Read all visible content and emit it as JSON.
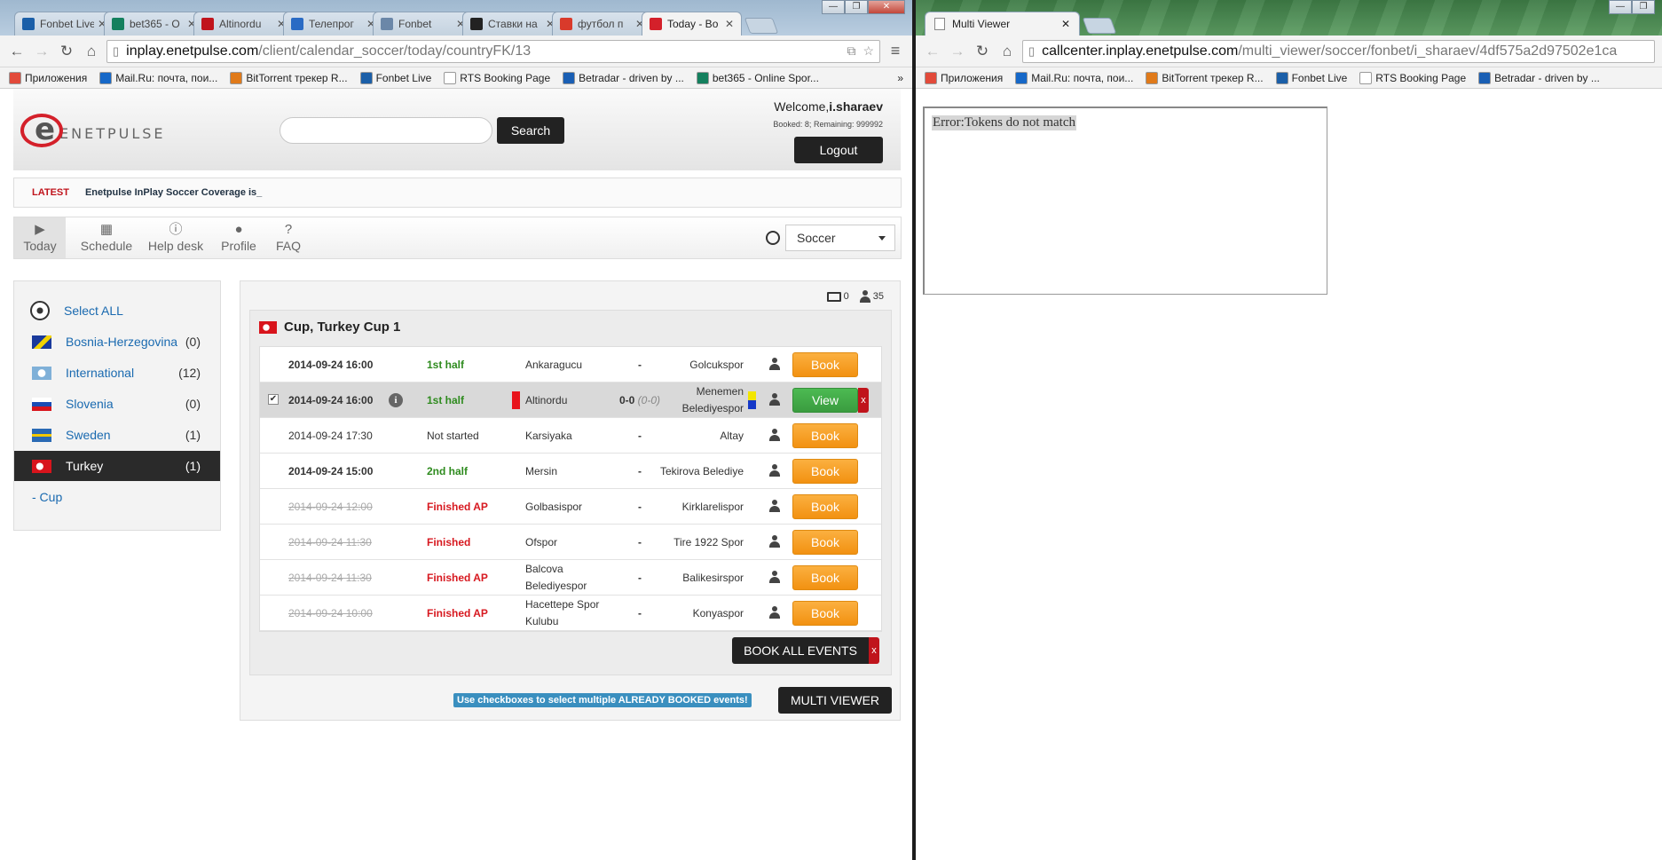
{
  "left_window": {
    "tabs": [
      {
        "title": "Fonbet Live",
        "color": "#1b5fa8"
      },
      {
        "title": "bet365 - O",
        "color": "#14805e"
      },
      {
        "title": "Altinordu",
        "color": "#c0141c"
      },
      {
        "title": "Телепрог",
        "color": "#2a6bc4"
      },
      {
        "title": "Fonbet",
        "color": "#6b87a8"
      },
      {
        "title": "Ставки на",
        "color": "#222222"
      },
      {
        "title": "футбол п",
        "color": "#d93a2b"
      },
      {
        "title": "Today - Bo",
        "color": "#d4202a"
      }
    ],
    "url_domain": "inplay.enetpulse.com",
    "url_path": "/client/calendar_soccer/today/countryFK/13",
    "bookmarks": [
      {
        "label": "Приложения",
        "color": "#e24a3a"
      },
      {
        "label": "Mail.Ru: почта, пои...",
        "color": "#1668c8"
      },
      {
        "label": "BitTorrent трекер R...",
        "color": "#e07a1a"
      },
      {
        "label": "Fonbet Live",
        "color": "#1b5fa8"
      },
      {
        "label": "RTS Booking Page",
        "color": "#ffffff"
      },
      {
        "label": "Betradar - driven by ...",
        "color": "#1a5fb4"
      },
      {
        "label": "bet365 - Online Spor...",
        "color": "#14805e"
      }
    ],
    "bookmarks_more": "»"
  },
  "header": {
    "logo_text": "ENETPULSE",
    "search_value": "",
    "search_label": "Search",
    "welcome_prefix": "Welcome,",
    "username": "i.sharaev",
    "booked_info": "Booked: 8; Remaining: 999992",
    "logout_label": "Logout"
  },
  "ticker": {
    "label": "LATEST",
    "text": "Enetpulse InPlay Soccer Coverage is_"
  },
  "nav": {
    "items": [
      {
        "label": "Today",
        "icon": "play-icon"
      },
      {
        "label": "Schedule",
        "icon": "calendar-icon"
      },
      {
        "label": "Help desk",
        "icon": "info-icon"
      },
      {
        "label": "Profile",
        "icon": "user-icon"
      },
      {
        "label": "FAQ",
        "icon": "question-icon"
      }
    ],
    "sport_selected": "Soccer"
  },
  "sidebar": {
    "select_all": "Select ALL",
    "countries": [
      {
        "name": "Bosnia-Herzegovina",
        "count": "(0)"
      },
      {
        "name": "International",
        "count": "(12)"
      },
      {
        "name": "Slovenia",
        "count": "(0)"
      },
      {
        "name": "Sweden",
        "count": "(1)"
      },
      {
        "name": "Turkey",
        "count": "(1)"
      }
    ],
    "sub_item": "- Cup"
  },
  "content": {
    "monitors_count": "0",
    "users_count": "35",
    "group_title": "Cup, Turkey Cup 1",
    "matches": [
      {
        "date": "2014-09-24 16:00",
        "status": "1st half",
        "home": "Ankaragucu",
        "score": "-",
        "score_ht": "",
        "away": "Golcukspor",
        "action": "Book"
      },
      {
        "date": "2014-09-24 16:00",
        "status": "1st half",
        "home": "Altinordu",
        "score": "0-0",
        "score_ht": "(0-0)",
        "away": "Menemen Belediyespor",
        "action": "View",
        "remove": "x"
      },
      {
        "date": "2014-09-24 17:30",
        "status": "Not started",
        "home": "Karsiyaka",
        "score": "-",
        "score_ht": "",
        "away": "Altay",
        "action": "Book"
      },
      {
        "date": "2014-09-24 15:00",
        "status": "2nd half",
        "home": "Mersin",
        "score": "-",
        "score_ht": "",
        "away": "Tekirova Belediye",
        "action": "Book"
      },
      {
        "date": "2014-09-24 12:00",
        "status": "Finished AP",
        "home": "Golbasispor",
        "score": "-",
        "score_ht": "",
        "away": "Kirklarelispor",
        "action": "Book"
      },
      {
        "date": "2014-09-24 11:30",
        "status": "Finished",
        "home": "Ofspor",
        "score": "-",
        "score_ht": "",
        "away": "Tire 1922 Spor",
        "action": "Book"
      },
      {
        "date": "2014-09-24 11:30",
        "status": "Finished AP",
        "home": "Balcova Belediyespor",
        "score": "-",
        "score_ht": "",
        "away": "Balikesirspor",
        "action": "Book"
      },
      {
        "date": "2014-09-24 10:00",
        "status": "Finished AP",
        "home": "Hacettepe Spor Kulubu",
        "score": "-",
        "score_ht": "",
        "away": "Konyaspor",
        "action": "Book"
      }
    ],
    "book_all_label": "BOOK ALL EVENTS",
    "book_all_remove": "x",
    "hint": "Use checkboxes to select multiple ALREADY BOOKED events!",
    "multi_viewer_label": "MULTI VIEWER"
  },
  "right_window": {
    "tab_title": "Multi Viewer",
    "url_domain": "callcenter.inplay.enetpulse.com",
    "url_path": "/multi_viewer/soccer/fonbet/i_sharaev/4df575a2d97502e1ca",
    "bookmarks": [
      {
        "label": "Приложения",
        "color": "#e24a3a"
      },
      {
        "label": "Mail.Ru: почта, пои...",
        "color": "#1668c8"
      },
      {
        "label": "BitTorrent трекер R...",
        "color": "#e07a1a"
      },
      {
        "label": "Fonbet Live",
        "color": "#1b5fa8"
      },
      {
        "label": "RTS Booking Page",
        "color": "#ffffff"
      },
      {
        "label": "Betradar - driven by ...",
        "color": "#1a5fb4"
      }
    ],
    "error_text": "Error:Tokens do not match"
  }
}
